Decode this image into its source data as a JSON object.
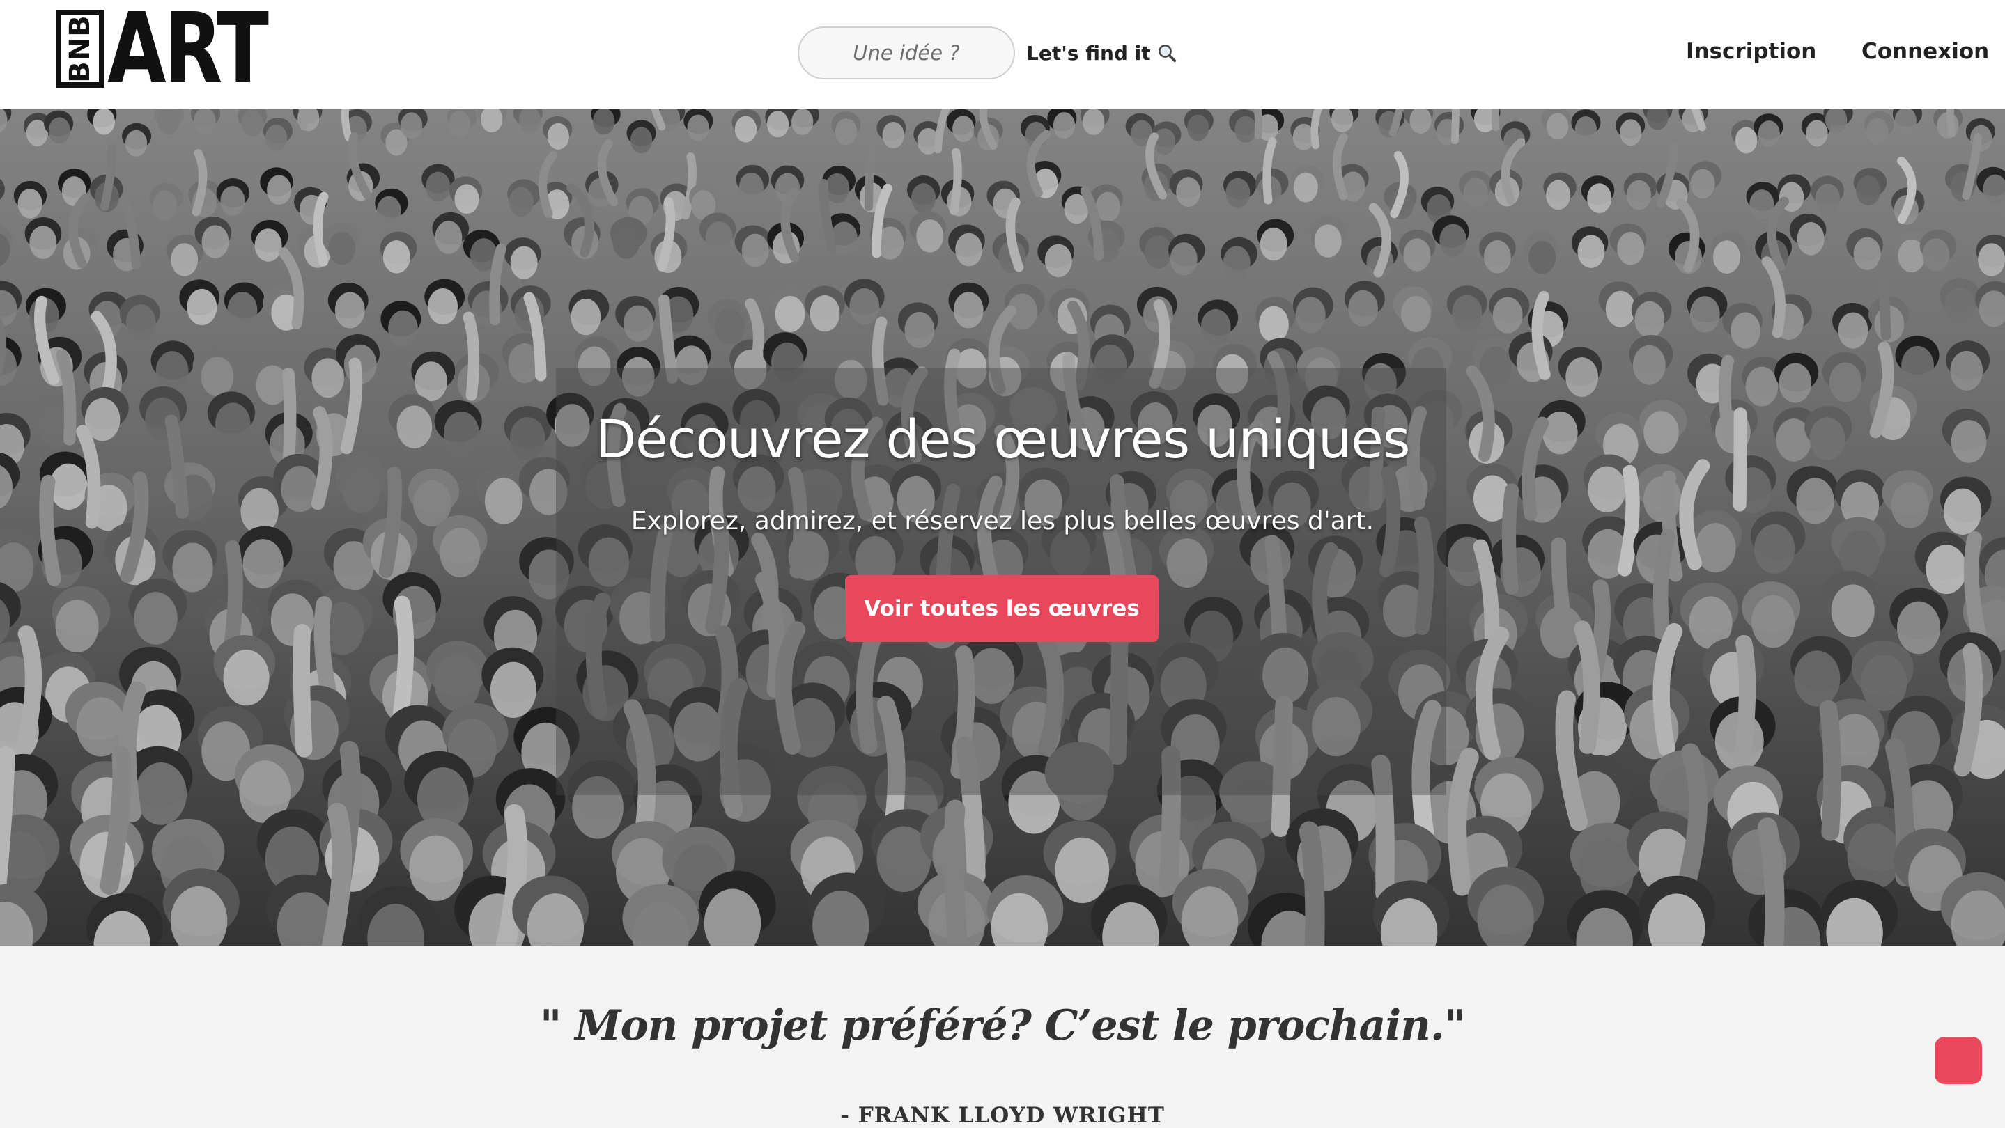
{
  "header": {
    "logo": {
      "small_text": "BNB",
      "big_text": "ART"
    },
    "search": {
      "placeholder": "Une idée ?",
      "button_label": "Let's find it",
      "button_icon": "magnifier-icon"
    },
    "nav": {
      "signup": "Inscription",
      "login": "Connexion"
    }
  },
  "hero": {
    "title": "Découvrez des œuvres uniques",
    "subtitle": "Explorez, admirez, et réservez les plus belles œuvres d'art.",
    "cta_label": "Voir toutes les œuvres"
  },
  "quote": {
    "text": "\" Mon projet préféré? C’est le prochain.\"",
    "author": "- FRANK LLOYD WRIGHT"
  },
  "colors": {
    "accent": "#e8475c",
    "navbar_bg": "#ffffff",
    "section_bg": "#f3f3f3",
    "text_dark": "#222222"
  },
  "floating_button": {
    "icon": "chat-icon"
  }
}
